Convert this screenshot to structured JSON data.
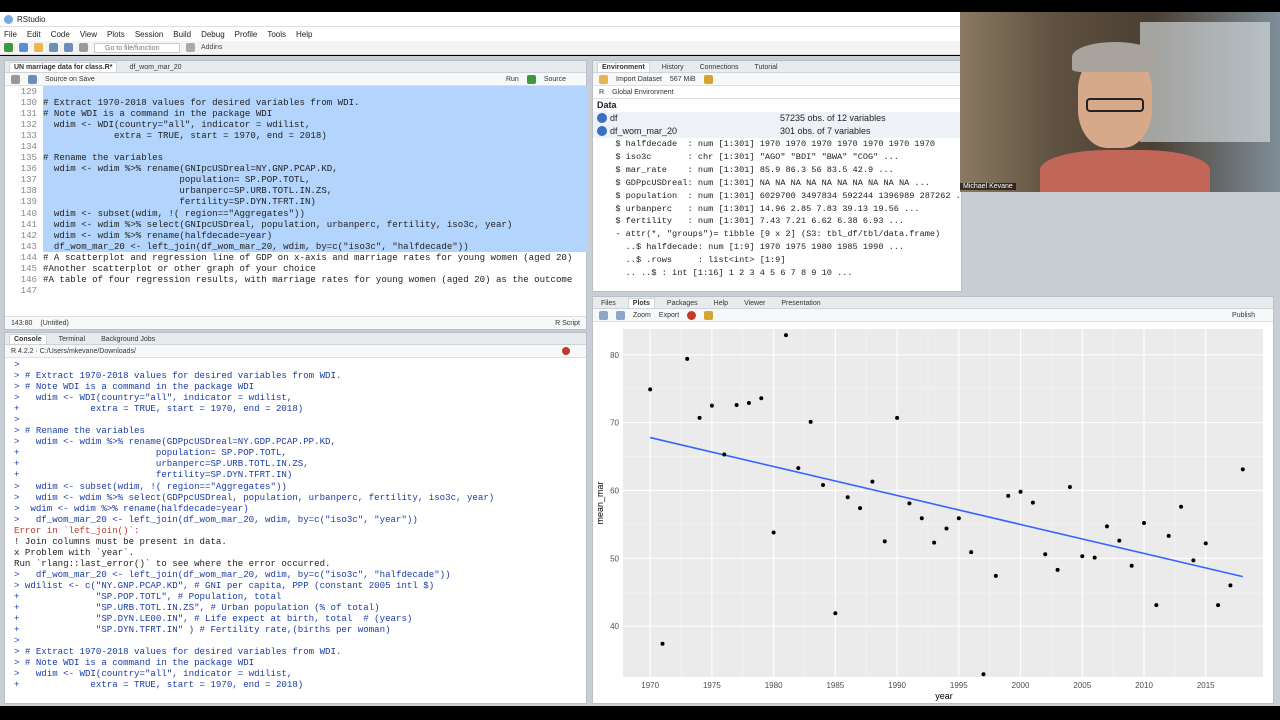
{
  "app": {
    "title": "RStudio"
  },
  "menu": [
    "File",
    "Edit",
    "Code",
    "View",
    "Plots",
    "Session",
    "Build",
    "Debug",
    "Profile",
    "Tools",
    "Help"
  ],
  "toolbar": {
    "goto": "Go to file/function",
    "addins": "Addins"
  },
  "editor": {
    "tabs": [
      "UN marriage data for class.R*",
      "df_wom_mar_20"
    ],
    "source_on_save": "Source on Save",
    "run": "Run",
    "source": "Source",
    "status_pos": "143:80",
    "status_scope": "(Untitled)",
    "status_type": "R Script",
    "lines": [
      {
        "n": "129",
        "t": "",
        "sel": true
      },
      {
        "n": "130",
        "t": "# Extract 1970-2018 values for desired variables from WDI.",
        "sel": true
      },
      {
        "n": "131",
        "t": "# Note WDI is a command in the package WDI",
        "sel": true
      },
      {
        "n": "132",
        "t": "  wdim <- WDI(country=\"all\", indicator = wdilist,",
        "sel": true
      },
      {
        "n": "133",
        "t": "             extra = TRUE, start = 1970, end = 2018)",
        "sel": true
      },
      {
        "n": "134",
        "t": "",
        "sel": true
      },
      {
        "n": "135",
        "t": "# Rename the variables",
        "sel": true
      },
      {
        "n": "136",
        "t": "  wdim <- wdim %>% rename(GNIpcUSDreal=NY.GNP.PCAP.KD,",
        "sel": true
      },
      {
        "n": "137",
        "t": "                         population= SP.POP.TOTL,",
        "sel": true
      },
      {
        "n": "138",
        "t": "                         urbanperc=SP.URB.TOTL.IN.ZS,",
        "sel": true
      },
      {
        "n": "139",
        "t": "                         fertility=SP.DYN.TFRT.IN)",
        "sel": true
      },
      {
        "n": "140",
        "t": "  wdim <- subset(wdim, !( region==\"Aggregates\"))",
        "sel": true
      },
      {
        "n": "141",
        "t": "  wdim <- wdim %>% select(GNIpcUSDreal, population, urbanperc, fertility, iso3c, year)",
        "sel": true
      },
      {
        "n": "142",
        "t": "  wdim <- wdim %>% rename(halfdecade=year)",
        "sel": true
      },
      {
        "n": "143",
        "t": "  df_wom_mar_20 <- left_join(df_wom_mar_20, wdim, by=c(\"iso3c\", \"halfdecade\"))",
        "sel": true
      },
      {
        "n": "144",
        "t": "# A scatterplot and regression line of GDP on x-axis and marriage rates for young women (aged 20)",
        "sel": false
      },
      {
        "n": "145",
        "t": "#Another scatterplot or other graph of your choice",
        "sel": false
      },
      {
        "n": "146",
        "t": "#A table of four regression results, with marriage rates for young women (aged 20) as the outcome",
        "sel": false
      },
      {
        "n": "147",
        "t": "",
        "sel": false
      }
    ]
  },
  "console": {
    "tabs": [
      "Console",
      "Terminal",
      "Background Jobs"
    ],
    "path": "R 4.2.2 · C:/Users/mkevane/Downloads/",
    "lines": [
      {
        "t": ">",
        "c": "cmd"
      },
      {
        "t": "> # Extract 1970-2018 values for desired variables from WDI.",
        "c": "cmd"
      },
      {
        "t": "> # Note WDI is a command in the package WDI",
        "c": "cmd"
      },
      {
        "t": ">   wdim <- WDI(country=\"all\", indicator = wdilist,",
        "c": "cmd"
      },
      {
        "t": "+             extra = TRUE, start = 1970, end = 2018)",
        "c": "cmd"
      },
      {
        "t": ">",
        "c": "cmd"
      },
      {
        "t": "> # Rename the variables",
        "c": "cmd"
      },
      {
        "t": ">   wdim <- wdim %>% rename(GDPpcUSDreal=NY.GDP.PCAP.PP.KD,",
        "c": "cmd"
      },
      {
        "t": "+                         population= SP.POP.TOTL,",
        "c": "cmd"
      },
      {
        "t": "+                         urbanperc=SP.URB.TOTL.IN.ZS,",
        "c": "cmd"
      },
      {
        "t": "+                         fertility=SP.DYN.TFRT.IN)",
        "c": "cmd"
      },
      {
        "t": ">   wdim <- subset(wdim, !( region==\"Aggregates\"))",
        "c": "cmd"
      },
      {
        "t": ">   wdim <- wdim %>% select(GDPpcUSDreal, population, urbanperc, fertility, iso3c, year)",
        "c": "cmd"
      },
      {
        "t": ">  wdim <- wdim %>% rename(halfdecade=year)",
        "c": "cmd"
      },
      {
        "t": ">   df_wom_mar_20 <- left_join(df_wom_mar_20, wdim, by=c(\"iso3c\", \"year\"))",
        "c": "cmd"
      },
      {
        "t": "Error in `left_join()`:",
        "c": "err"
      },
      {
        "t": "! Join columns must be present in data.",
        "c": ""
      },
      {
        "t": "x Problem with `year`.",
        "c": ""
      },
      {
        "t": "Run `rlang::last_error()` to see where the error occurred.",
        "c": ""
      },
      {
        "t": ">   df_wom_mar_20 <- left_join(df_wom_mar_20, wdim, by=c(\"iso3c\", \"halfdecade\"))",
        "c": "cmd"
      },
      {
        "t": "> wdilist <- c(\"NY.GNP.PCAP.KD\", # GNI per capita, PPP (constant 2005 intl $)",
        "c": "cmd"
      },
      {
        "t": "+              \"SP.POP.TOTL\", # Population, total",
        "c": "cmd"
      },
      {
        "t": "+              \"SP.URB.TOTL.IN.ZS\", # Urban population (% of total)",
        "c": "cmd"
      },
      {
        "t": "+              \"SP.DYN.LE00.IN\", # Life expect at birth, total  # (years)",
        "c": "cmd"
      },
      {
        "t": "+              \"SP.DYN.TFRT.IN\" ) # Fertility rate,(births per woman)",
        "c": "cmd"
      },
      {
        "t": ">",
        "c": "cmd"
      },
      {
        "t": "> # Extract 1970-2018 values for desired variables from WDI.",
        "c": "cmd"
      },
      {
        "t": "> # Note WDI is a command in the package WDI",
        "c": "cmd"
      },
      {
        "t": ">   wdim <- WDI(country=\"all\", indicator = wdilist,",
        "c": "cmd"
      },
      {
        "t": "+             extra = TRUE, start = 1970, end = 2018)",
        "c": "cmd"
      },
      {
        "t": ">",
        "c": "cmd"
      }
    ]
  },
  "environment": {
    "tabs": [
      "Environment",
      "History",
      "Connections",
      "Tutorial"
    ],
    "import": "Import Dataset",
    "memory": "567 MiB",
    "lang": "R",
    "scope": "Global Environment",
    "section": "Data",
    "objects": [
      {
        "name": "df",
        "desc": "57235 obs. of 12 variables"
      },
      {
        "name": "df_wom_mar_20",
        "desc": "301 obs. of 7 variables"
      }
    ],
    "rows": [
      "  $ halfdecade  : num [1:301] 1970 1970 1970 1970 1970 1970 1970",
      "  $ iso3c       : chr [1:301] \"AGO\" \"BDI\" \"BWA\" \"COG\" ...",
      "  $ mar_rate    : num [1:301] 85.9 86.3 56 83.5 42.9 ...",
      "  $ GDPpcUSDreal: num [1:301] NA NA NA NA NA NA NA NA NA NA ...",
      "  $ population  : num [1:301] 6029700 3497834 592244 1396989 287262 ...",
      "  $ urbanperc   : num [1:301] 14.96 2.85 7.83 39.13 19.56 ...",
      "  $ fertility   : num [1:301] 7.43 7.21 6.62 6.38 6.93 ...",
      "  - attr(*, \"groups\")= tibble [9 x 2] (S3: tbl_df/tbl/data.frame)",
      "    ..$ halfdecade: num [1:9] 1970 1975 1980 1985 1990 ...",
      "    ..$ .rows     : list<int> [1:9]",
      "    .. ..$ : int [1:16] 1 2 3 4 5 6 7 8 9 10 ..."
    ]
  },
  "plots": {
    "tabs": [
      "Files",
      "Plots",
      "Packages",
      "Help",
      "Viewer",
      "Presentation"
    ],
    "zoom": "Zoom",
    "export": "Export",
    "publish": "Publish"
  },
  "webcam": {
    "name": "Michael Kevane"
  },
  "chart_data": {
    "type": "scatter",
    "xlabel": "year",
    "ylabel": "mean_mar",
    "xlim": [
      1967.8,
      2019.8
    ],
    "ylim": [
      32.5,
      83.8
    ],
    "xticks": [
      1970,
      1975,
      1980,
      1985,
      1990,
      1995,
      2000,
      2005,
      2010,
      2015
    ],
    "yticks": [
      40,
      50,
      60,
      70,
      80
    ],
    "grid": true,
    "points": [
      [
        1970,
        74.9
      ],
      [
        1971,
        37.4
      ],
      [
        1973,
        79.4
      ],
      [
        1974,
        70.7
      ],
      [
        1975,
        72.5
      ],
      [
        1976,
        65.3
      ],
      [
        1977,
        72.6
      ],
      [
        1978,
        72.9
      ],
      [
        1979,
        73.6
      ],
      [
        1980,
        53.8
      ],
      [
        1981,
        82.9
      ],
      [
        1982,
        63.3
      ],
      [
        1983,
        70.1
      ],
      [
        1984,
        60.8
      ],
      [
        1985,
        41.9
      ],
      [
        1986,
        59.0
      ],
      [
        1987,
        57.4
      ],
      [
        1988,
        61.3
      ],
      [
        1989,
        52.5
      ],
      [
        1990,
        70.7
      ],
      [
        1991,
        58.1
      ],
      [
        1992,
        55.9
      ],
      [
        1993,
        52.3
      ],
      [
        1994,
        54.4
      ],
      [
        1995,
        55.9
      ],
      [
        1996,
        50.9
      ],
      [
        1997,
        32.9
      ],
      [
        1998,
        47.4
      ],
      [
        1999,
        59.2
      ],
      [
        2000,
        59.8
      ],
      [
        2001,
        58.2
      ],
      [
        2002,
        50.6
      ],
      [
        2003,
        48.3
      ],
      [
        2004,
        60.5
      ],
      [
        2005,
        50.3
      ],
      [
        2006,
        50.1
      ],
      [
        2007,
        54.7
      ],
      [
        2008,
        52.6
      ],
      [
        2009,
        48.9
      ],
      [
        2010,
        55.2
      ],
      [
        2011,
        43.1
      ],
      [
        2012,
        53.3
      ],
      [
        2013,
        57.6
      ],
      [
        2014,
        49.7
      ],
      [
        2015,
        52.2
      ],
      [
        2016,
        43.1
      ],
      [
        2017,
        46.0
      ],
      [
        2018,
        63.1
      ]
    ],
    "fit_line": {
      "x": [
        1970,
        2018
      ],
      "y": [
        67.8,
        47.3
      ],
      "color": "#3366ff"
    }
  }
}
